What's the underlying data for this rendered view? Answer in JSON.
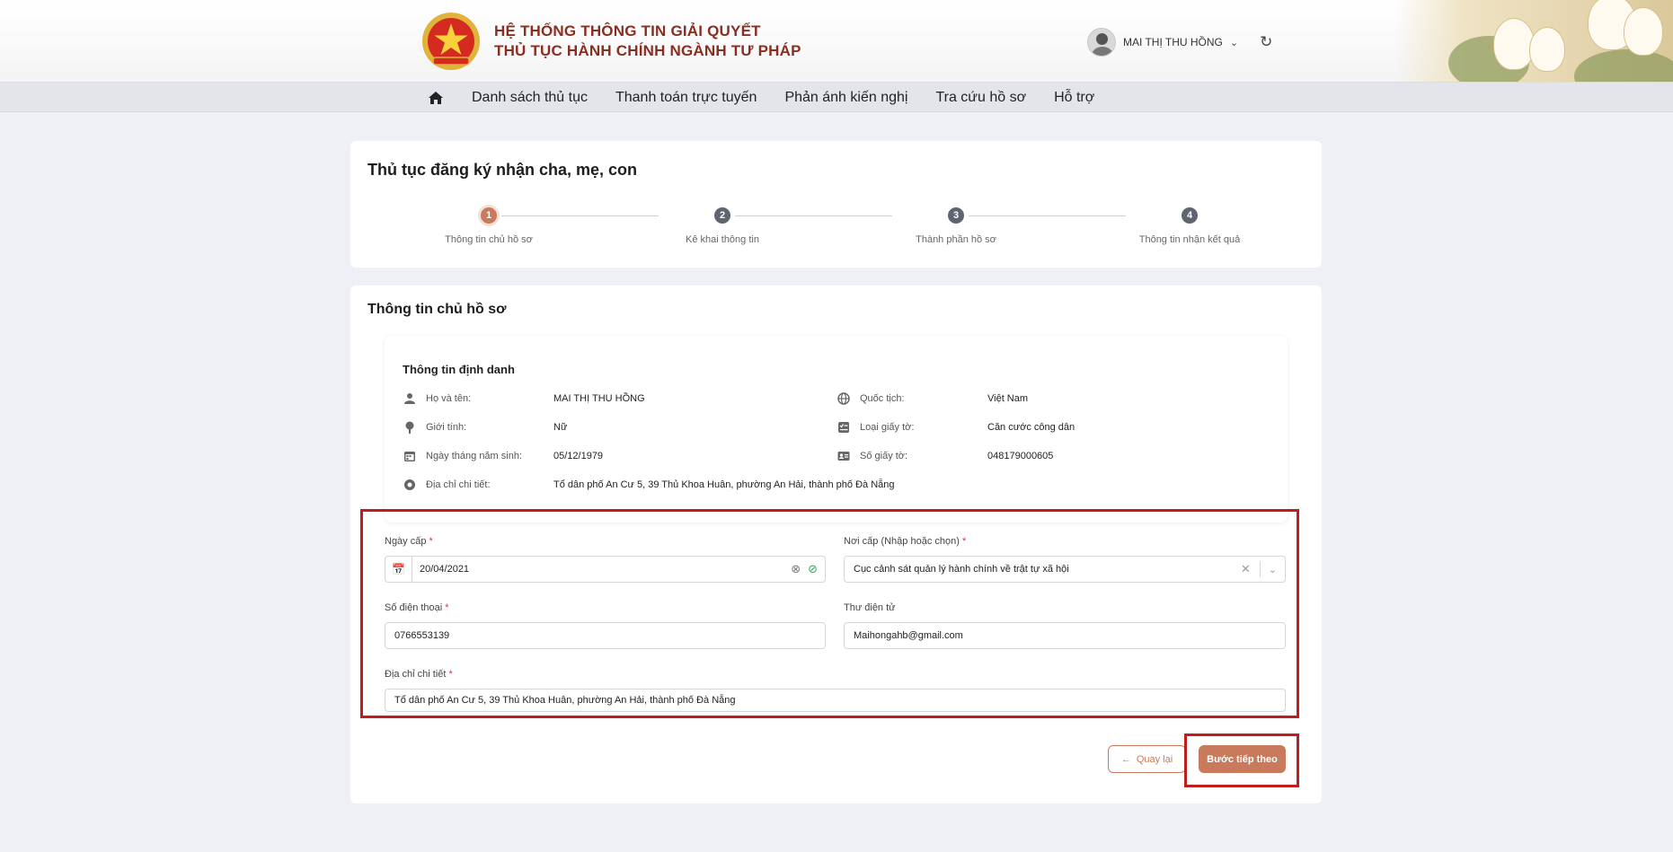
{
  "header": {
    "brand_line1": "HỆ THỐNG THÔNG TIN GIẢI QUYẾT",
    "brand_line2": "THỦ TỤC HÀNH CHÍNH NGÀNH TƯ PHÁP",
    "user_name": "MAI THỊ THU HỒNG"
  },
  "nav": {
    "items": [
      {
        "label": "Danh sách thủ tục"
      },
      {
        "label": "Thanh toán trực tuyến"
      },
      {
        "label": "Phản ánh kiến nghị"
      },
      {
        "label": "Tra cứu hồ sơ"
      },
      {
        "label": "Hỗ trợ"
      }
    ]
  },
  "page": {
    "title": "Thủ tục đăng ký nhận cha, mẹ, con"
  },
  "stepper": {
    "steps": [
      {
        "num": "1",
        "label": "Thông tin chủ hồ sơ"
      },
      {
        "num": "2",
        "label": "Kê khai thông tin"
      },
      {
        "num": "3",
        "label": "Thành phần hồ sơ"
      },
      {
        "num": "4",
        "label": "Thông tin nhận kết quả"
      }
    ]
  },
  "section": {
    "title": "Thông tin chủ hồ sơ",
    "identity_title": "Thông tin định danh",
    "rows": [
      {
        "label": "Họ và tên:",
        "value": "MAI THỊ THU HỒNG"
      },
      {
        "label": "Quốc tịch:",
        "value": "Việt Nam"
      },
      {
        "label": "Giới tính:",
        "value": "Nữ"
      },
      {
        "label": "Loại giấy tờ:",
        "value": "Căn cước công dân"
      },
      {
        "label": "Ngày tháng năm sinh:",
        "value": "05/12/1979"
      },
      {
        "label": "Số giấy tờ:",
        "value": "048179000605"
      },
      {
        "label": "Địa chỉ chi tiết:",
        "value": "Tổ dân phố An Cư 5, 39 Thủ Khoa Huân, phường An Hải, thành phố Đà Nẵng"
      }
    ]
  },
  "form": {
    "issue_date_label": "Ngày cấp",
    "issue_date_value": "20/04/2021",
    "issue_place_label": "Nơi cấp (Nhập hoặc chọn)",
    "issue_place_value": "Cục cảnh sát quản lý hành chính về trật tự xã hội",
    "phone_label": "Số điện thoại",
    "phone_value": "0766553139",
    "email_label": "Thư điện tử",
    "email_value": "Maihongahb@gmail.com",
    "address_label": "Địa chỉ chi tiết",
    "address_value": "Tổ dân phố An Cư 5, 39 Thủ Khoa Huân, phường An Hải, thành phố Đà Nẵng",
    "required_mark": "*"
  },
  "actions": {
    "back_label": "Quay lại",
    "next_label": "Bước tiếp theo"
  },
  "colors": {
    "brand": "#8b2e22",
    "accent": "#c97a5c",
    "highlight": "#c01e1e"
  }
}
